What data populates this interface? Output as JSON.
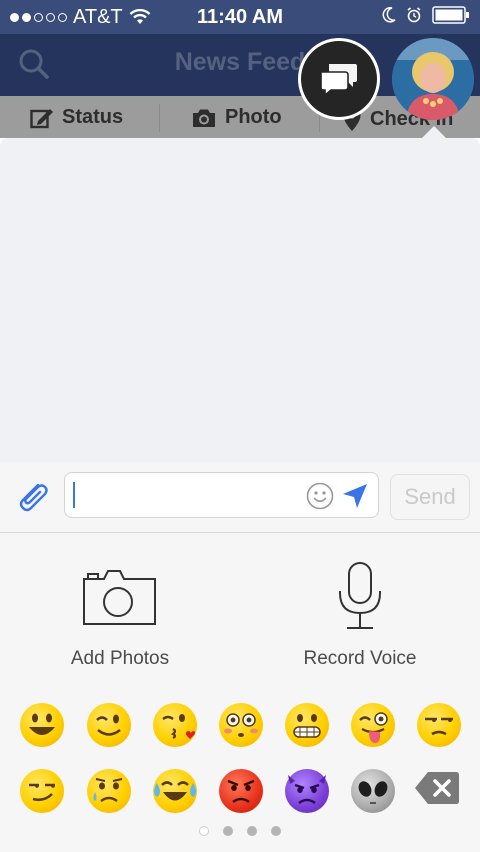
{
  "status_bar": {
    "carrier": "AT&T",
    "time": "11:40 AM",
    "signal_filled": 2,
    "signal_total": 5
  },
  "nav": {
    "title": "News Feed"
  },
  "composer": {
    "status": "Status",
    "photo": "Photo",
    "checkin": "Check In"
  },
  "chat": {
    "input_value": "",
    "input_placeholder": "",
    "send_label": "Send"
  },
  "tray": {
    "add_photos": "Add Photos",
    "record_voice": "Record Voice"
  },
  "emoji_rows": [
    [
      "smiley",
      "wink",
      "kissing-heart",
      "flushed",
      "grimacing",
      "stuck-out-tongue-winking-eye",
      "unamused"
    ],
    [
      "smirk",
      "disappointed-relieved",
      "joy",
      "rage",
      "imp",
      "alien"
    ]
  ],
  "pager": {
    "pages": 4,
    "current": 1
  },
  "colors": {
    "status_bar": "#3a4d7a",
    "nav_bar": "#24345d",
    "accent": "#3b74e7",
    "emoji_yellow": "#ffd000"
  }
}
